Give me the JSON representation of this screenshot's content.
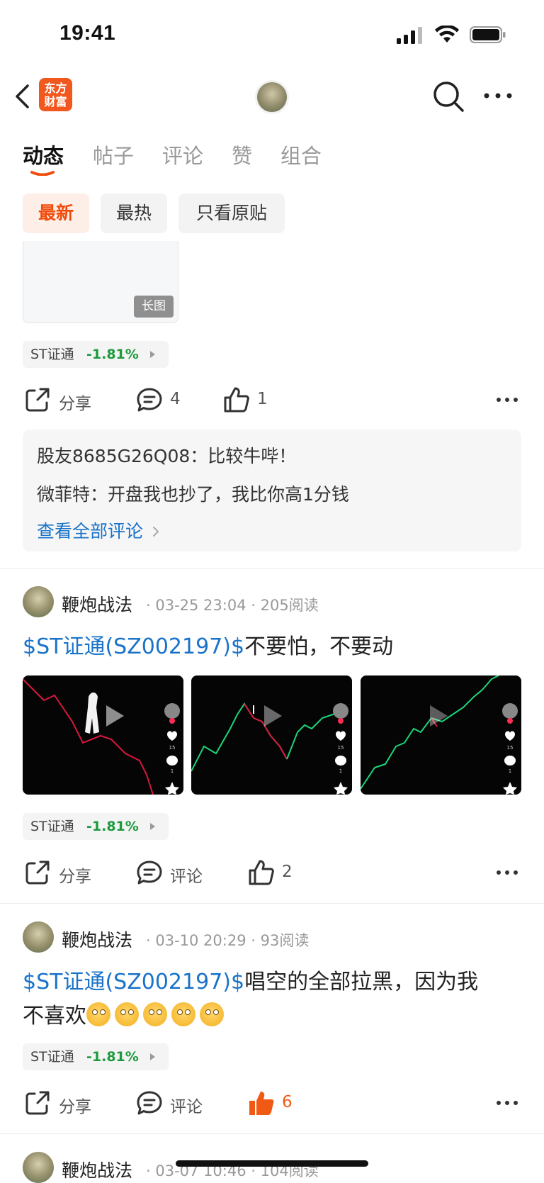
{
  "status_bar": {
    "time": "19:41"
  },
  "nav": {
    "logo_line1": "东方",
    "logo_line2": "财富"
  },
  "tabs": [
    {
      "label": "动态"
    },
    {
      "label": "帖子"
    },
    {
      "label": "评论"
    },
    {
      "label": "赞"
    },
    {
      "label": "组合"
    }
  ],
  "filters": [
    {
      "label": "最新"
    },
    {
      "label": "最热"
    },
    {
      "label": "只看原贴"
    }
  ],
  "post1": {
    "long_image_tag": "长图",
    "stock": {
      "name": "ST证通",
      "change": "-1.81%"
    },
    "actions": {
      "share": "分享",
      "comments": "4",
      "likes": "1"
    },
    "comments": [
      {
        "user": "股友8685G26Q08：",
        "text": "比较牛哔！"
      },
      {
        "user": "微菲特：",
        "text": "开盘我也抄了，我比你高1分钱"
      }
    ],
    "see_all": "查看全部评论"
  },
  "post2": {
    "author": "鞭炮战法",
    "date": "03-25 23:04",
    "reads": "205阅读",
    "link": "$ST证通(SZ002197)$",
    "text": "不要怕，不要动",
    "stock": {
      "name": "ST证通",
      "change": "-1.81%"
    },
    "actions": {
      "share": "分享",
      "comment": "评论",
      "likes": "2"
    },
    "video_likes": [
      "15",
      "15",
      "15"
    ],
    "video_comments": [
      "1",
      "1",
      "1"
    ]
  },
  "post3": {
    "author": "鞭炮战法",
    "date": "03-10 20:29",
    "reads": "93阅读",
    "link": "$ST证通(SZ002197)$",
    "text_line1": "唱空的全部拉黑，因为我",
    "text_line2": "不喜欢",
    "stock": {
      "name": "ST证通",
      "change": "-1.81%"
    },
    "actions": {
      "share": "分享",
      "comment": "评论",
      "likes": "6"
    }
  },
  "post4": {
    "author": "鞭炮战法",
    "date": "03-07 10:46",
    "reads": "104阅读"
  },
  "colors": {
    "accent": "#f04c0d",
    "link": "#1a73c9",
    "down": "#1c9a3e"
  }
}
